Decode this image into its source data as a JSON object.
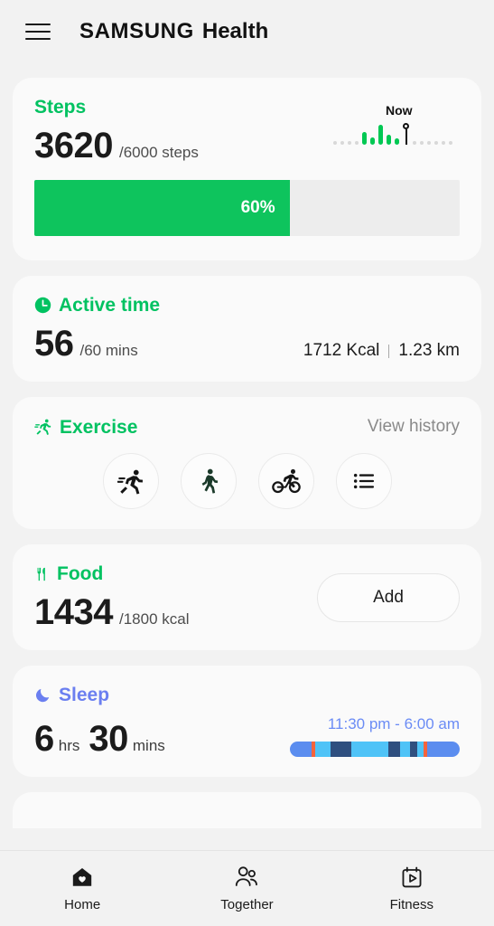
{
  "header": {
    "menu_icon": "hamburger-menu-icon",
    "brand_samsung": "SAMSUNG",
    "brand_health": "Health"
  },
  "colors": {
    "accent_green": "#00c261",
    "progress_green": "#0ec45d",
    "sleep_blue": "#6b7ff0",
    "page_bg": "#f2f2f2",
    "card_bg": "#fafafa"
  },
  "cards": {
    "steps": {
      "title": "Steps",
      "value": "3620",
      "goal": "/6000 steps",
      "progress_label": "60%",
      "progress_percent": 60,
      "now_label": "Now",
      "sparkline": {
        "left_dots": 4,
        "bars": [
          14,
          8,
          22,
          11,
          7
        ],
        "right_dots": 6
      }
    },
    "active_time": {
      "title": "Active time",
      "icon": "clock-icon",
      "value": "56",
      "goal": "/60 mins",
      "calories": "1712 Kcal",
      "distance": "1.23 km"
    },
    "exercise": {
      "title": "Exercise",
      "icon": "running-icon",
      "view_history": "View history",
      "buttons": [
        {
          "name": "run",
          "icon": "running-icon"
        },
        {
          "name": "walk",
          "icon": "walking-icon"
        },
        {
          "name": "cycle",
          "icon": "cycling-icon"
        },
        {
          "name": "more",
          "icon": "list-icon"
        }
      ]
    },
    "food": {
      "title": "Food",
      "icon": "cutlery-icon",
      "value": "1434",
      "goal": "/1800 kcal",
      "add_label": "Add"
    },
    "sleep": {
      "title": "Sleep",
      "icon": "moon-icon",
      "hours": "6",
      "hours_unit": "hrs",
      "minutes": "30",
      "minutes_unit": "mins",
      "time_range": "11:30 pm - 6:00 am",
      "stages": [
        {
          "color": "#5b8def",
          "width": 13
        },
        {
          "color": "#f4643c",
          "width": 2
        },
        {
          "color": "#4fc3f7",
          "width": 9
        },
        {
          "color": "#2f4f7f",
          "width": 12
        },
        {
          "color": "#4fc3f7",
          "width": 22
        },
        {
          "color": "#2f4f7f",
          "width": 7
        },
        {
          "color": "#4fc3f7",
          "width": 6
        },
        {
          "color": "#2f4f7f",
          "width": 4
        },
        {
          "color": "#4fc3f7",
          "width": 4
        },
        {
          "color": "#f4643c",
          "width": 2
        },
        {
          "color": "#5b8def",
          "width": 19
        }
      ]
    }
  },
  "bottom_nav": [
    {
      "label": "Home",
      "icon": "home-heart-icon",
      "active": true
    },
    {
      "label": "Together",
      "icon": "people-icon",
      "active": false
    },
    {
      "label": "Fitness",
      "icon": "calendar-play-icon",
      "active": false
    }
  ]
}
